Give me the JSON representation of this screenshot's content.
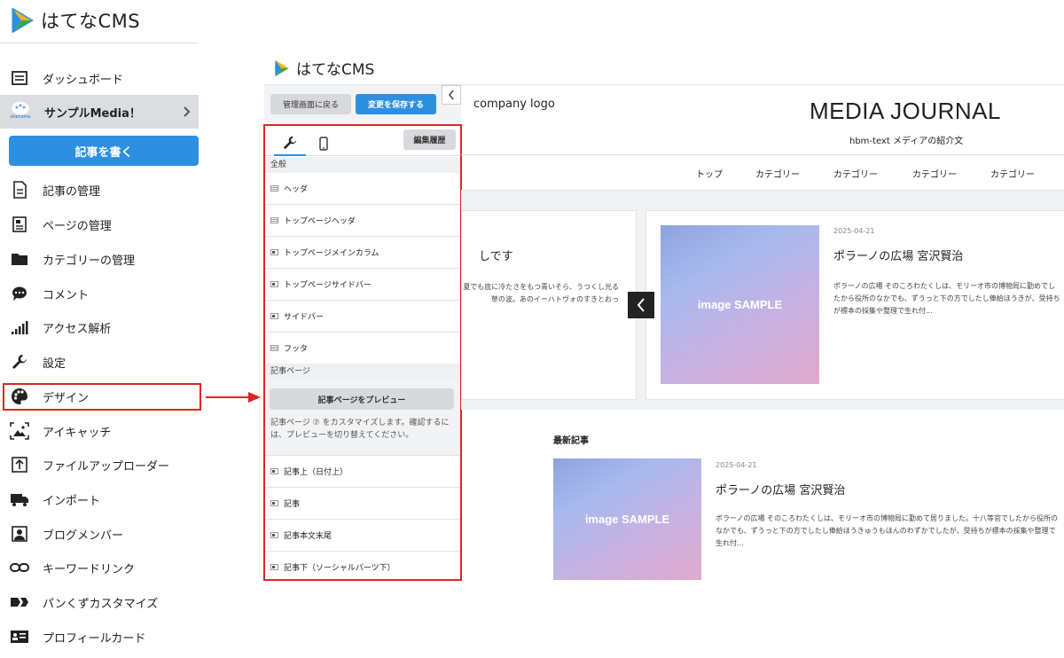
{
  "app": {
    "brand": "はてなCMS"
  },
  "sidebar": {
    "items": [
      {
        "label": "ダッシュボード",
        "icon": "dashboard-icon"
      },
      {
        "label": "記事の管理",
        "icon": "document-icon"
      },
      {
        "label": "ページの管理",
        "icon": "pages-icon"
      },
      {
        "label": "カテゴリーの管理",
        "icon": "folder-icon"
      },
      {
        "label": "コメント",
        "icon": "comment-icon"
      },
      {
        "label": "アクセス解析",
        "icon": "analytics-icon"
      },
      {
        "label": "設定",
        "icon": "wrench-icon"
      },
      {
        "label": "デザイン",
        "icon": "palette-icon"
      },
      {
        "label": "アイキャッチ",
        "icon": "eyecatch-icon"
      },
      {
        "label": "ファイルアップローダー",
        "icon": "upload-icon"
      },
      {
        "label": "インポート",
        "icon": "truck-icon"
      },
      {
        "label": "ブログメンバー",
        "icon": "member-icon"
      },
      {
        "label": "キーワードリンク",
        "icon": "link-icon"
      },
      {
        "label": "パンくずカスタマイズ",
        "icon": "breadcrumb-icon"
      },
      {
        "label": "プロフィールカード",
        "icon": "profile-card-icon"
      }
    ],
    "media": {
      "label": "サンプルMedia！",
      "icon_text": "sitename"
    },
    "write_button": "記事を書く"
  },
  "editor": {
    "brand": "はてなCMS",
    "back_button": "管理画面に戻る",
    "save_button": "変更を保存する",
    "history_button": "編集履歴",
    "section_general": "全般",
    "general_rows": [
      "ヘッダ",
      "トップページヘッダ",
      "トップページメインカラム",
      "トップページサイドバー",
      "サイドバー",
      "フッタ"
    ],
    "section_article": "記事ページ",
    "preview_button": "記事ページをプレビュー",
    "preview_desc": "記事ページ ⑦ をカスタマイズします。確認するには、プレビューを切り替えてください。",
    "article_rows": [
      "記事上（日付上）",
      "記事",
      "記事本文末尾",
      "記事下（ソーシャルパーツ下）"
    ]
  },
  "site": {
    "company_logo": "company logo",
    "title": "MEDIA JOURNAL",
    "tagline": "hbm-text メディアの紹介文",
    "nav": [
      "トップ",
      "カテゴリー",
      "カテゴリー",
      "カテゴリー",
      "カテゴリー"
    ],
    "featured_left": {
      "title": "しです",
      "excerpt": "夏でも底に冷たさをもつ青いそら、うつくし光る草の波。あのイーハトヴォのすきとおっ"
    },
    "featured_right": {
      "date": "2025-04-21",
      "title": "ポラーノの広場 宮沢賢治",
      "excerpt": "ポラーノの広場 そのころわたくしは、モリーオ市の博物局に勤めでしたから役所のなかでも、ずうっと下の方でしたし俸給ほうきが、受持ちが標本の採集や整理で生れ付...",
      "image_label": "image SAMPLE"
    },
    "latest_heading": "最新記事",
    "latest_post": {
      "date": "2025-04-21",
      "title": "ポラーノの広場 宮沢賢治",
      "excerpt": "ポラーノの広場 そのころわたくしは、モリーオ市の博物局に勤めて居りました。十八等官でしたから役所のなかでも、ずうっと下の方でしたし俸給ほうきゅうもほんのわずかでしたが、受持ちが標本の採集や整理で生れ付...",
      "image_label": "image SAMPLE"
    }
  },
  "colors": {
    "accent": "#2d8fe0",
    "highlight": "#e02424"
  }
}
